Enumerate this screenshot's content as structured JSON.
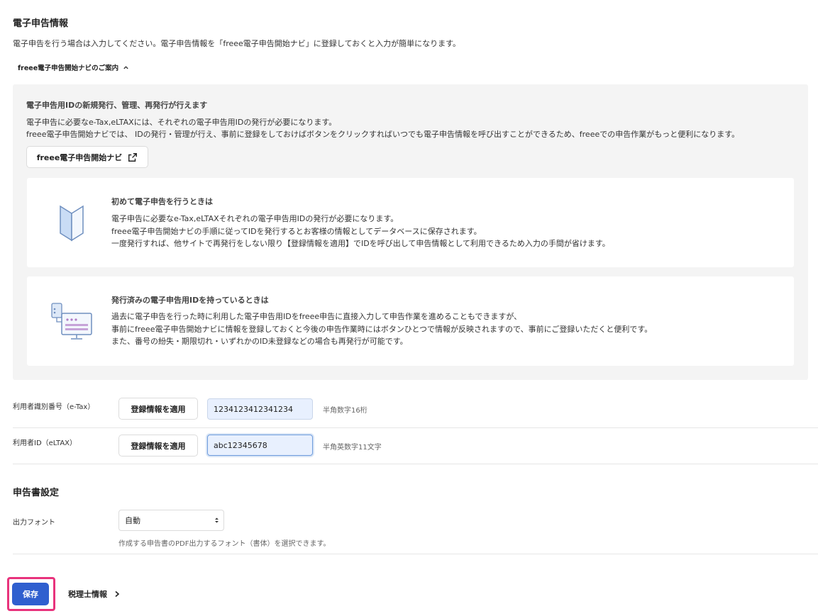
{
  "section1": {
    "title": "電子申告情報",
    "description": "電子申告を行う場合は入力してください。電子申告情報を「freee電子申告開始ナビ」に登録しておくと入力が簡単になります。",
    "toggle_label": "freee電子申告開始ナビのご案内"
  },
  "guide": {
    "heading": "電子申告用IDの新規発行、管理、再発行が行えます",
    "line1": "電子申告に必要なe-Tax,eLTAXには、それぞれの電子申告用IDの発行が必要になります。",
    "line2": "freee電子申告開始ナビでは、 IDの発行・管理が行え、事前に登録をしておけばボタンをクリックすればいつでも電子申告情報を呼び出すことができるため、freeeでの申告作業がもっと便利になります。",
    "navi_button": "freee電子申告開始ナビ"
  },
  "card1": {
    "title": "初めて電子申告を行うときは",
    "line1": "電子申告に必要なe-Tax,eLTAXそれぞれの電子申告用IDの発行が必要になります。",
    "line2": "freee電子申告開始ナビの手順に従ってIDを発行するとお客様の情報としてデータベースに保存されます。",
    "line3": "一度発行すれば、他サイトで再発行をしない限り【登録情報を適用】でIDを呼び出して申告情報として利用できるため入力の手間が省けます。"
  },
  "card2": {
    "title": "発行済みの電子申告用IDを持っているときは",
    "line1": "過去に電子申告を行った時に利用した電子申告用IDをfreee申告に直接入力して申告作業を進めることもできますが、",
    "line2": "事前にfreee電子申告開始ナビに情報を登録しておくと今後の申告作業時にはボタンひとつで情報が反映されますので、事前にご登録いただくと便利です。",
    "line3": "また、番号の紛失・期限切れ・いずれかのID未登録などの場合も再発行が可能です。"
  },
  "fields": {
    "etax": {
      "label": "利用者識別番号（e-Tax）",
      "apply_button": "登録情報を適用",
      "value": "1234123412341234",
      "hint": "半角数字16桁"
    },
    "eltax": {
      "label": "利用者ID（eLTAX）",
      "apply_button": "登録情報を適用",
      "value": "abc12345678",
      "hint": "半角英数字11文字"
    }
  },
  "section2": {
    "title": "申告書設定",
    "font_label": "出力フォント",
    "font_selected": "自動",
    "font_hint": "作成する申告書のPDF出力するフォント（書体）を選択できます。"
  },
  "footer": {
    "save_label": "保存",
    "next_label": "税理士情報"
  },
  "icons": {
    "toggle": "chevron-up-icon",
    "external": "external-link-icon",
    "beginner": "beginner-mark-icon",
    "monitor": "monitor-id-icon",
    "select": "select-arrows-icon",
    "next": "chevron-right-icon"
  },
  "colors": {
    "primary": "#2f5fcf",
    "highlight": "#e8337c",
    "panel": "#f4f4f4",
    "input_bg": "#e8f0fe"
  }
}
